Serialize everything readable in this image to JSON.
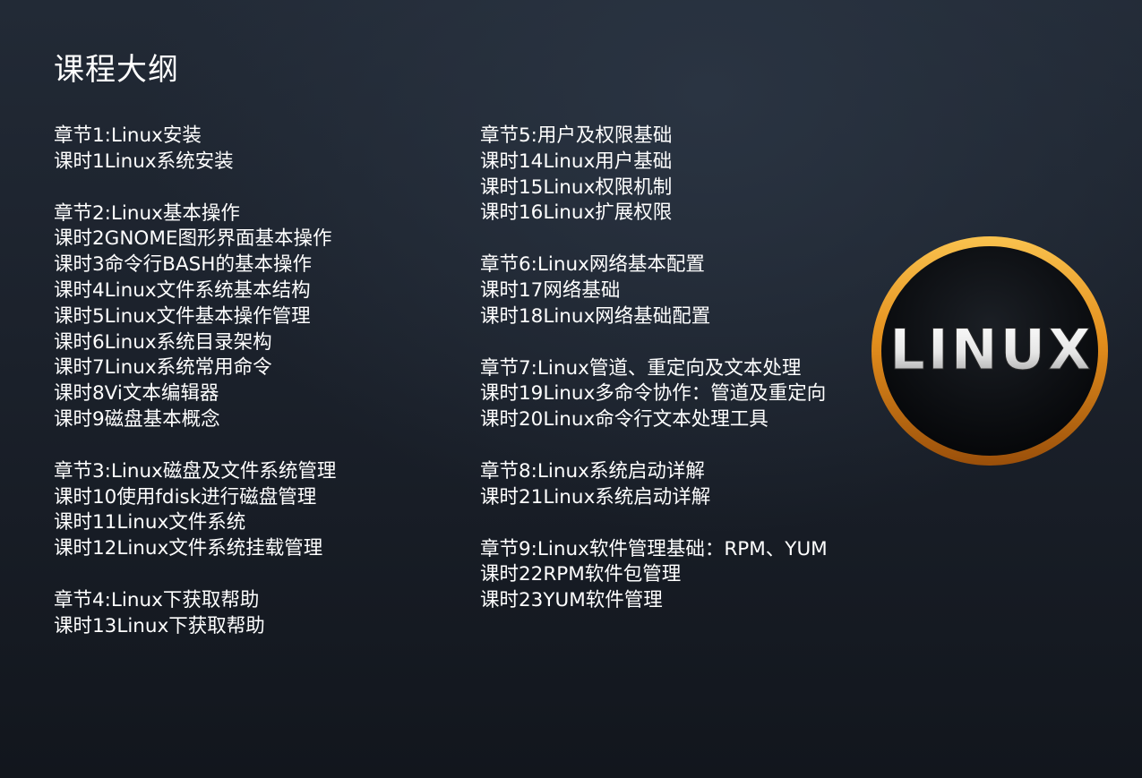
{
  "page": {
    "title": "课程大纲"
  },
  "logo": {
    "text": "LINUX",
    "ring_color_light": "#f7b640",
    "ring_color_dark": "#a95a0c",
    "inner_color": "#0b0d10"
  },
  "left_column": [
    {
      "chapter": "章节1:Linux安装",
      "lessons": [
        "课时1Linux系统安装"
      ]
    },
    {
      "chapter": "章节2:Linux基本操作",
      "lessons": [
        "课时2GNOME图形界面基本操作",
        "课时3命令行BASH的基本操作",
        "课时4Linux文件系统基本结构",
        "课时5Linux文件基本操作管理",
        "课时6Linux系统目录架构",
        "课时7Linux系统常用命令",
        "课时8Vi文本编辑器",
        "课时9磁盘基本概念"
      ]
    },
    {
      "chapter": "章节3:Linux磁盘及文件系统管理",
      "lessons": [
        "课时10使用fdisk进行磁盘管理",
        "课时11Linux文件系统",
        "课时12Linux文件系统挂载管理"
      ]
    },
    {
      "chapter": "章节4:Linux下获取帮助",
      "lessons": [
        "课时13Linux下获取帮助"
      ]
    }
  ],
  "right_column": [
    {
      "chapter": "章节5:用户及权限基础",
      "lessons": [
        "课时14Linux用户基础",
        "课时15Linux权限机制",
        "课时16Linux扩展权限"
      ]
    },
    {
      "chapter": "章节6:Linux网络基本配置",
      "lessons": [
        "课时17网络基础",
        "课时18Linux网络基础配置"
      ]
    },
    {
      "chapter": "章节7:Linux管道、重定向及文本处理",
      "lessons": [
        "课时19Linux多命令协作：管道及重定向",
        "课时20Linux命令行文本处理工具"
      ]
    },
    {
      "chapter": "章节8:Linux系统启动详解",
      "lessons": [
        "课时21Linux系统启动详解"
      ]
    },
    {
      "chapter": "章节9:Linux软件管理基础：RPM、YUM",
      "lessons": [
        "课时22RPM软件包管理",
        "课时23YUM软件管理"
      ]
    }
  ]
}
